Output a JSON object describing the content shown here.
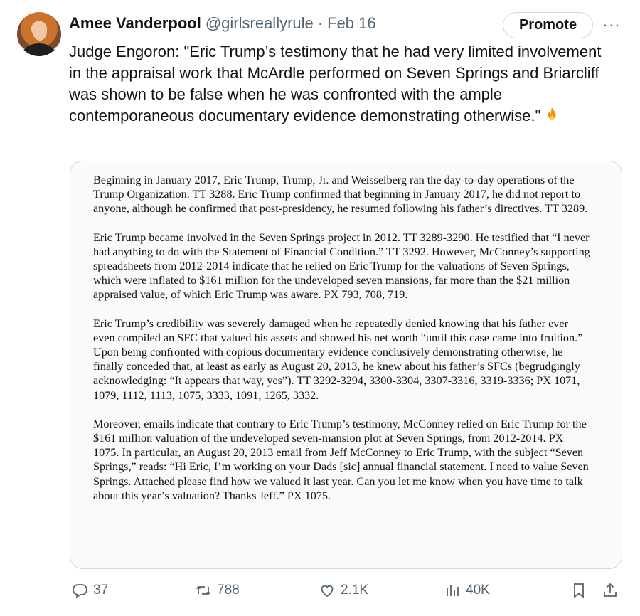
{
  "author": {
    "name": "Amee Vanderpool",
    "handle": "@girlsreallyrule",
    "separator": "·",
    "date": "Feb 16"
  },
  "promote_label": "Promote",
  "more_label": "···",
  "tweet_text": "Judge Engoron: \"Eric Trump’s testimony that he had very limited involvement in the appraisal work that McArdle performed on Seven Springs and Briarcliff was shown to be false when he was confronted with the ample contemporaneous documentary evidence demonstrating otherwise.\"",
  "emoji_icon": "fire-emoji-icon",
  "document": {
    "paragraphs": [
      "Beginning in January 2017, Eric Trump, Trump, Jr. and Weisselberg ran the day-to-day operations of the Trump Organization.  TT 3288.  Eric Trump confirmed that beginning in January 2017, he did not report to anyone, although he confirmed that post-presidency, he resumed following his father’s directives.  TT 3289.",
      "Eric Trump became involved in the Seven Springs project in 2012.  TT 3289-3290.  He testified that “I never had anything to do with the Statement of Financial Condition.”  TT 3292.  However, McConney’s supporting spreadsheets from 2012-2014 indicate that he relied on Eric Trump for the valuations of Seven Springs, which were inflated to $161 million for the undeveloped seven mansions, far more than the $21 million appraised value, of which Eric Trump was aware.  PX 793, 708, 719.",
      "Eric Trump’s credibility was severely damaged when he repeatedly denied knowing that his father ever even compiled an SFC that valued his assets and showed his net worth “until this case came into fruition.”  Upon being confronted with copious documentary evidence conclusively demonstrating otherwise, he finally conceded that, at least as early as August 20, 2013, he knew about his father’s SFCs (begrudgingly acknowledging: “It appears that way, yes”).  TT 3292-3294, 3300-3304, 3307-3316, 3319-3336; PX 1071, 1079, 1112, 1113, 1075, 3333, 1091, 1265, 3332.",
      "Moreover, emails indicate that contrary to Eric Trump’s testimony, McConney relied on Eric Trump for the $161 million valuation of the undeveloped seven-mansion plot at Seven Springs, from 2012-2014.  PX 1075.  In particular, an August 20, 2013 email from Jeff McConney to Eric Trump, with the subject “Seven Springs,” reads: “Hi Eric, I’m working on your Dads [sic] annual financial statement.  I need to value Seven Springs.  Attached please find how we valued it last year.  Can you let me know when you have time to talk about this year’s valuation?  Thanks Jeff.”  PX 1075."
    ]
  },
  "actions": {
    "replies": "37",
    "reposts": "788",
    "likes": "2.1K",
    "views": "40K"
  },
  "colors": {
    "text": "#0f1419",
    "secondary": "#536471",
    "border": "#cfd9de"
  }
}
